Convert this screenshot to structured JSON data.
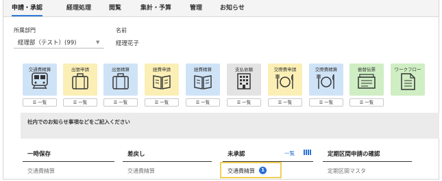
{
  "tabs": [
    {
      "label": "申請・承認",
      "active": true
    },
    {
      "label": "経理処理",
      "active": false
    },
    {
      "label": "閲覧",
      "active": false
    },
    {
      "label": "集計・予算",
      "active": false
    },
    {
      "label": "管理",
      "active": false
    },
    {
      "label": "お知らせ",
      "active": false
    }
  ],
  "profile": {
    "department_label": "所属部門",
    "department_value": "経理部（テスト）(99)",
    "name_label": "名前",
    "name_value": "経理花子"
  },
  "tiles": [
    {
      "label": "交通費精算",
      "color": "#cfe3f7",
      "icon": "train-icon",
      "list_label": "一覧"
    },
    {
      "label": "出張申請",
      "color": "#fbefb6",
      "icon": "suitcase-icon",
      "list_label": "一覧"
    },
    {
      "label": "出張精算",
      "color": "#cfe3f7",
      "icon": "suitcase-icon",
      "list_label": "一覧"
    },
    {
      "label": "経費申請",
      "color": "#fbefb6",
      "icon": "book-icon",
      "list_label": "一覧"
    },
    {
      "label": "経費精算",
      "color": "#cfe3f7",
      "icon": "book-icon",
      "list_label": "一覧"
    },
    {
      "label": "支払依頼",
      "color": "#e3e3e3",
      "icon": "building-icon",
      "list_label": "一覧"
    },
    {
      "label": "交際費申請",
      "color": "#fbefb6",
      "icon": "dining-icon",
      "list_label": "一覧"
    },
    {
      "label": "交際費精算",
      "color": "#cfe3f7",
      "icon": "dining-icon",
      "list_label": "一覧"
    },
    {
      "label": "振替伝票",
      "color": "#cfeec4",
      "icon": "voucher-icon",
      "list_label": "一覧"
    },
    {
      "label": "ワークフロー",
      "color": "#cfeec4",
      "icon": "document-icon",
      "list_label": ""
    }
  ],
  "notice": {
    "text": "社内でのお知らせ事項などをご記入ください"
  },
  "columns": {
    "draft": {
      "title": "一時保存",
      "item": "交通費精算"
    },
    "returned": {
      "title": "差戻し",
      "item": "交通費精算"
    },
    "pending": {
      "title": "未承認",
      "link": "一覧",
      "item": "交通費精算",
      "badge": "1"
    },
    "periodic": {
      "title": "定期区間申請の確認",
      "item": "定期区間マスタ"
    }
  },
  "colors": {
    "accent": "#2a6fd6",
    "highlight": "#f2cf55"
  }
}
